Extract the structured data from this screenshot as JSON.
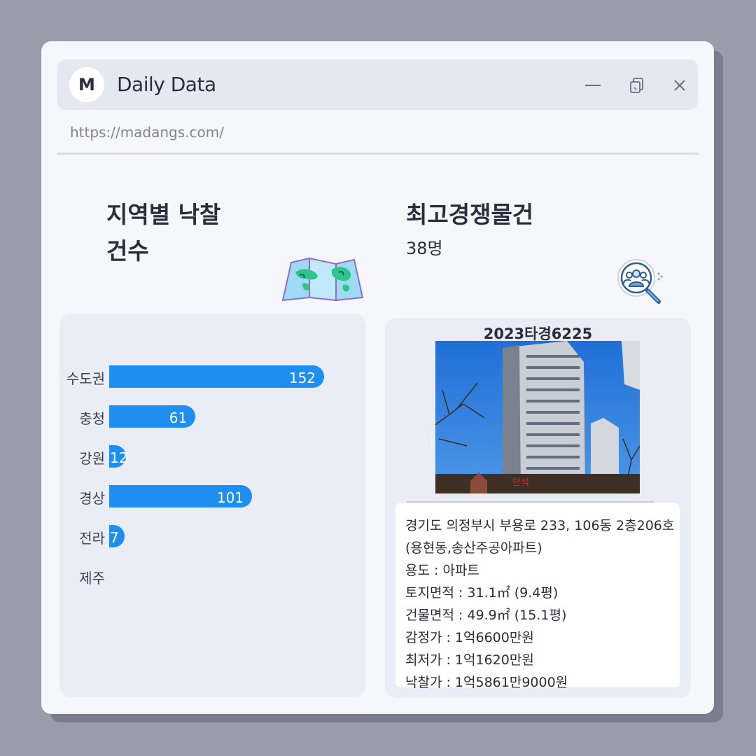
{
  "window": {
    "logo_letter": "M",
    "title": "Daily Data",
    "url": "https://madangs.com/"
  },
  "left_section": {
    "title_line1": "지역별 낙찰",
    "title_line2": "건수",
    "icon": "folded-map-icon"
  },
  "right_section": {
    "title": "최고경쟁물건",
    "subtitle": "38명",
    "icon": "people-search-icon"
  },
  "chart_data": {
    "type": "bar",
    "orientation": "horizontal",
    "categories": [
      "수도권",
      "충청",
      "강원",
      "경상",
      "전라",
      "제주"
    ],
    "values": [
      152,
      61,
      12,
      101,
      7,
      0
    ],
    "color": "#1e8ef0"
  },
  "property": {
    "case_number": "2023타경6225",
    "photo_text": "만석",
    "address_line1": "경기도 의정부시 부용로 233, 106동 2층206호",
    "address_line2": "(용현동,송산주공아파트)",
    "usage": "용도 : 아파트",
    "land_area": "토지면적 : 31.1㎡ (9.4평)",
    "building_area": "건물면적 : 49.9㎡ (15.1평)",
    "appraised_price": "감정가 : 1억6600만원",
    "minimum_price": "최저가 : 1억1620만원",
    "winning_bid": "낙찰가 : 1억5861만9000원"
  },
  "colors": {
    "background": "#9a9bab",
    "window": "#f6f7fc",
    "titlebar": "#e6e8f1",
    "panel": "#ebedf6",
    "bar": "#1e8ef0",
    "text": "#2b2d3c"
  }
}
